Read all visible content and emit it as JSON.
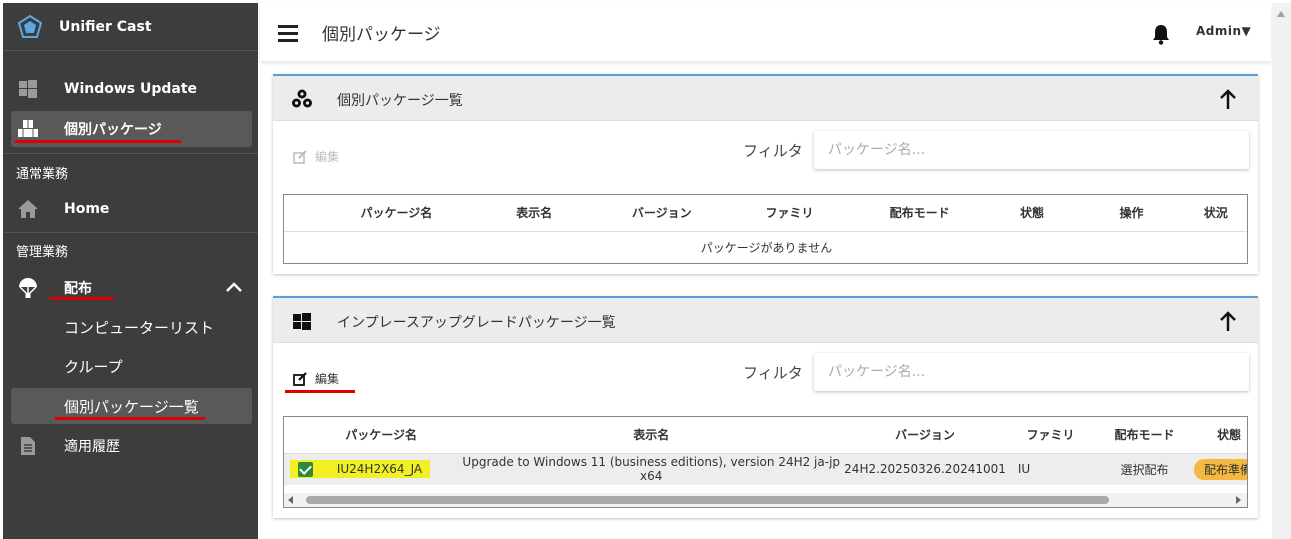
{
  "app": {
    "name": "Unifier Cast"
  },
  "sidebar": {
    "items": [
      {
        "label": "Windows Update"
      },
      {
        "label": "個別パッケージ"
      }
    ],
    "section_regular": "通常業務",
    "home": "Home",
    "section_admin": "管理業務",
    "distribution": "配布",
    "sub_items": [
      {
        "label": "コンピューターリスト"
      },
      {
        "label": "クループ"
      },
      {
        "label": "個別パッケージ一覧"
      }
    ],
    "history": "適用履歴"
  },
  "header": {
    "title": "個別パッケージ",
    "user": "Admin▼"
  },
  "card1": {
    "title": "個別パッケージ一覧",
    "edit_label": "編集",
    "filter_label": "フィルタ",
    "filter_placeholder": "パッケージ名...",
    "columns": [
      "パッケージ名",
      "表示名",
      "バージョン",
      "ファミリ",
      "配布モード",
      "状態",
      "操作",
      "状況"
    ],
    "empty_text": "パッケージがありません"
  },
  "card2": {
    "title": "インプレースアップグレードパッケージ一覧",
    "edit_label": "編集",
    "filter_label": "フィルタ",
    "filter_placeholder": "パッケージ名...",
    "columns": [
      "パッケージ名",
      "表示名",
      "バージョン",
      "ファミリ",
      "配布モード",
      "状態"
    ],
    "rows": [
      {
        "package": "IU24H2X64_JA",
        "display": "Upgrade to Windows 11 (business editions), version 24H2 ja-jp x64",
        "version": "24H2.20250326.20241001",
        "family": "IU",
        "mode": "選択配布",
        "status": "配布準備"
      }
    ]
  },
  "colors": {
    "sidebar_bg": "#3d3d3d",
    "accent": "#5a9fd8",
    "status_badge": "#f5b942",
    "highlight": "#f2ef24"
  }
}
